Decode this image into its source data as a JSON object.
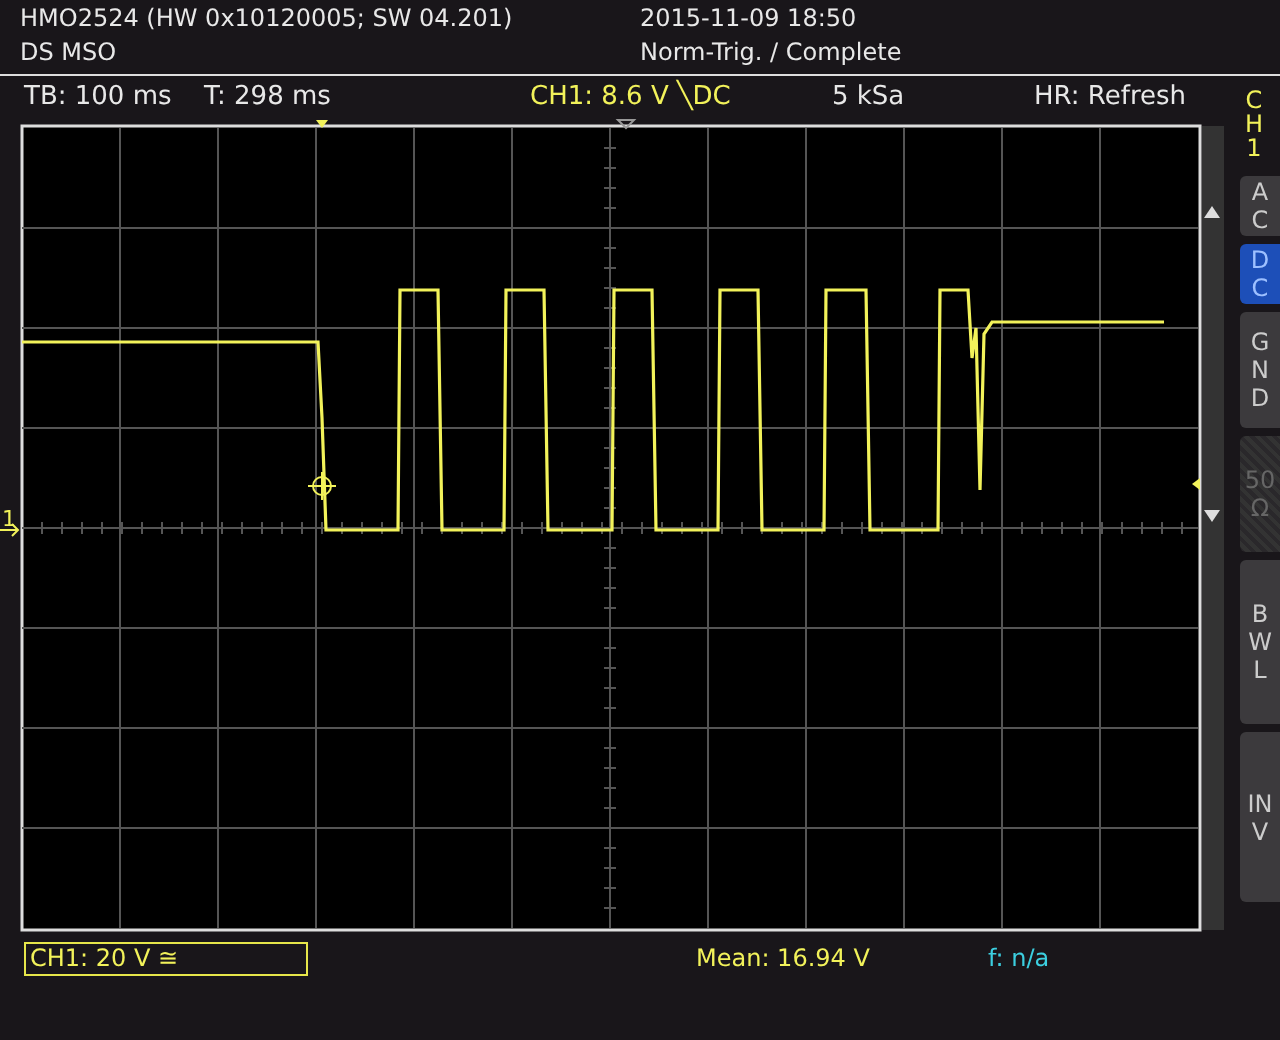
{
  "header": {
    "model_info": "HMO2524 (HW 0x10120005; SW 04.201)",
    "mode": "DS MSO",
    "datetime": "2015-11-09 18:50",
    "trigger_status": "Norm-Trig. / Complete"
  },
  "info_bar": {
    "timebase": "TB: 100 ms",
    "trigger_time": "T: 298 ms",
    "channel_trigger": "CH1: 8.6 V ╲DC",
    "sample_rate": "5 kSa",
    "acquisition_mode": "HR: Refresh"
  },
  "plot": {
    "channel_marker": "1"
  },
  "side_panel": {
    "channel_label": "CH1",
    "buttons": [
      {
        "label": "AC",
        "selected": false,
        "disabled": false
      },
      {
        "label": "DC",
        "selected": true,
        "disabled": false
      },
      {
        "label": "GND",
        "selected": false,
        "disabled": false
      },
      {
        "label": "50Ω",
        "selected": false,
        "disabled": true
      },
      {
        "label": "BWL",
        "selected": false,
        "disabled": false
      },
      {
        "label": "INV",
        "selected": false,
        "disabled": false
      }
    ]
  },
  "footer": {
    "channel_scale": "CH1: 20 V ≅",
    "mean": "Mean: 16.94 V",
    "frequency": "f: n/a"
  }
}
